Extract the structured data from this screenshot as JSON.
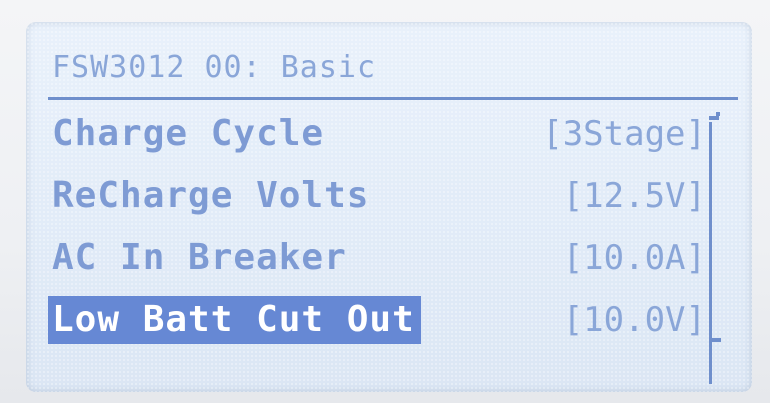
{
  "display": {
    "title": "FSW3012 00: Basic",
    "menu": [
      {
        "label": "Charge Cycle",
        "value": "[3Stage]"
      },
      {
        "label": "ReCharge Volts",
        "value": "[12.5V]"
      },
      {
        "label": "AC In Breaker",
        "value": "[10.0A]"
      },
      {
        "label": "Low Batt Cut Out",
        "value": "[10.0V]",
        "selected": true
      }
    ]
  },
  "colors": {
    "lcd_background": "#e2ecf8",
    "text": "#7e9bd4",
    "highlight": "#6688d4"
  }
}
